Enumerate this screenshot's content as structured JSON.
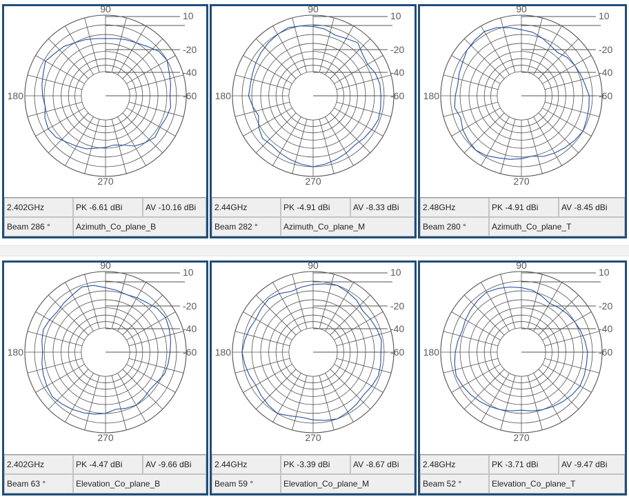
{
  "chart_data": [
    {
      "type": "polar",
      "title": "Azimuth_Co_plane_B",
      "frequency": "2.402GHz",
      "peak": "PK -6.61 dBi",
      "average": "AV -10.16 dBi",
      "beam": "Beam 286 °",
      "angle_labels": [
        "90",
        "180",
        "270"
      ],
      "radial_labels": [
        "10",
        "-20",
        "-40",
        "-60"
      ],
      "radius_scale": [
        0.3,
        0.55,
        1.0
      ],
      "series": [
        {
          "r": [
            0.8,
            0.82,
            0.84,
            0.88,
            0.86,
            0.8,
            0.76,
            0.74,
            0.72,
            0.71,
            0.72,
            0.74,
            0.76,
            0.8,
            0.82,
            0.86,
            0.82,
            0.8,
            0.78,
            0.76,
            0.8,
            0.82,
            0.8,
            0.75,
            0.72,
            0.7,
            0.66,
            0.64,
            0.62,
            0.65,
            0.72,
            0.76,
            0.8,
            0.78,
            0.8,
            0.82
          ]
        }
      ]
    },
    {
      "type": "polar",
      "title": "Azimuth_Co_plane_M",
      "frequency": "2.44GHz",
      "peak": "PK -4.91 dBi",
      "average": "AV -8.33 dBi",
      "beam": "Beam 282 °",
      "angle_labels": [
        "90",
        "180",
        "270"
      ],
      "radial_labels": [
        "10",
        "-20",
        "-40",
        "-60"
      ],
      "radius_scale": [
        0.3,
        0.55,
        1.0
      ],
      "series": [
        {
          "r": [
            0.84,
            0.84,
            0.82,
            0.78,
            0.8,
            0.86,
            0.82,
            0.8,
            0.84,
            0.86,
            0.88,
            0.9,
            0.88,
            0.86,
            0.84,
            0.82,
            0.8,
            0.79,
            0.8,
            0.76,
            0.72,
            0.78,
            0.82,
            0.8,
            0.82,
            0.84,
            0.86,
            0.88,
            0.86,
            0.84,
            0.82,
            0.8,
            0.82,
            0.84,
            0.86,
            0.85
          ]
        }
      ]
    },
    {
      "type": "polar",
      "title": "Azimuth_Co_plane_T",
      "frequency": "2.48GHz",
      "peak": "PK -4.91 dBi",
      "average": "AV -8.45 dBi",
      "beam": "Beam 280 °",
      "angle_labels": [
        "90",
        "180",
        "270"
      ],
      "radial_labels": [
        "10",
        "-20",
        "-40",
        "-60"
      ],
      "radius_scale": [
        0.3,
        0.55,
        1.0
      ],
      "series": [
        {
          "r": [
            0.84,
            0.8,
            0.78,
            0.76,
            0.74,
            0.7,
            0.72,
            0.76,
            0.8,
            0.82,
            0.86,
            0.9,
            0.92,
            0.9,
            0.88,
            0.84,
            0.82,
            0.8,
            0.82,
            0.84,
            0.8,
            0.84,
            0.86,
            0.88,
            0.86,
            0.82,
            0.8,
            0.78,
            0.76,
            0.8,
            0.82,
            0.84,
            0.86,
            0.88,
            0.86,
            0.85
          ]
        }
      ]
    },
    {
      "type": "polar",
      "title": "Elevation_Co_plane_B",
      "frequency": "2.402GHz",
      "peak": "PK -4.47 dBi",
      "average": "AV -9.66 dBi",
      "beam": "Beam 63 °",
      "angle_labels": [
        "90",
        "180",
        "270"
      ],
      "radial_labels": [
        "10",
        "-20",
        "-40",
        "-60"
      ],
      "radius_scale": [
        0.3,
        0.55,
        1.0
      ],
      "series": [
        {
          "r": [
            0.8,
            0.82,
            0.84,
            0.86,
            0.84,
            0.8,
            0.78,
            0.76,
            0.78,
            0.8,
            0.84,
            0.86,
            0.82,
            0.8,
            0.78,
            0.8,
            0.82,
            0.8,
            0.78,
            0.8,
            0.82,
            0.84,
            0.86,
            0.84,
            0.82,
            0.8,
            0.78,
            0.76,
            0.72,
            0.74,
            0.76,
            0.74,
            0.72,
            0.74,
            0.78,
            0.79
          ]
        }
      ]
    },
    {
      "type": "polar",
      "title": "Elevation_Co_plane_M",
      "frequency": "2.44GHz",
      "peak": "PK -3.39 dBi",
      "average": "AV -8.67 dBi",
      "beam": "Beam 59 °",
      "angle_labels": [
        "90",
        "180",
        "270"
      ],
      "radial_labels": [
        "10",
        "-20",
        "-40",
        "-60"
      ],
      "radius_scale": [
        0.3,
        0.55,
        1.0
      ],
      "series": [
        {
          "r": [
            0.84,
            0.86,
            0.84,
            0.82,
            0.8,
            0.84,
            0.86,
            0.88,
            0.86,
            0.84,
            0.82,
            0.8,
            0.84,
            0.86,
            0.84,
            0.82,
            0.84,
            0.86,
            0.88,
            0.86,
            0.84,
            0.82,
            0.84,
            0.86,
            0.88,
            0.84,
            0.82,
            0.84,
            0.86,
            0.88,
            0.86,
            0.84,
            0.82,
            0.84,
            0.86,
            0.85
          ]
        }
      ]
    },
    {
      "type": "polar",
      "title": "Elevation_Co_plane_T",
      "frequency": "2.48GHz",
      "peak": "PK -3.71 dBi",
      "average": "AV -9.47 dBi",
      "beam": "Beam 52 °",
      "angle_labels": [
        "90",
        "180",
        "270"
      ],
      "radial_labels": [
        "10",
        "-20",
        "-40",
        "-60"
      ],
      "radius_scale": [
        0.3,
        0.55,
        1.0
      ],
      "series": [
        {
          "r": [
            0.82,
            0.8,
            0.78,
            0.76,
            0.74,
            0.72,
            0.7,
            0.74,
            0.78,
            0.8,
            0.82,
            0.84,
            0.86,
            0.84,
            0.82,
            0.8,
            0.78,
            0.8,
            0.82,
            0.84,
            0.86,
            0.84,
            0.82,
            0.8,
            0.78,
            0.76,
            0.74,
            0.72,
            0.74,
            0.76,
            0.78,
            0.8,
            0.82,
            0.84,
            0.83,
            0.82
          ]
        }
      ]
    }
  ],
  "colors": {
    "frame": "#1f4e79",
    "grid": "#505050",
    "trace": "#1f4fa0",
    "label": "#5a5a5a"
  }
}
